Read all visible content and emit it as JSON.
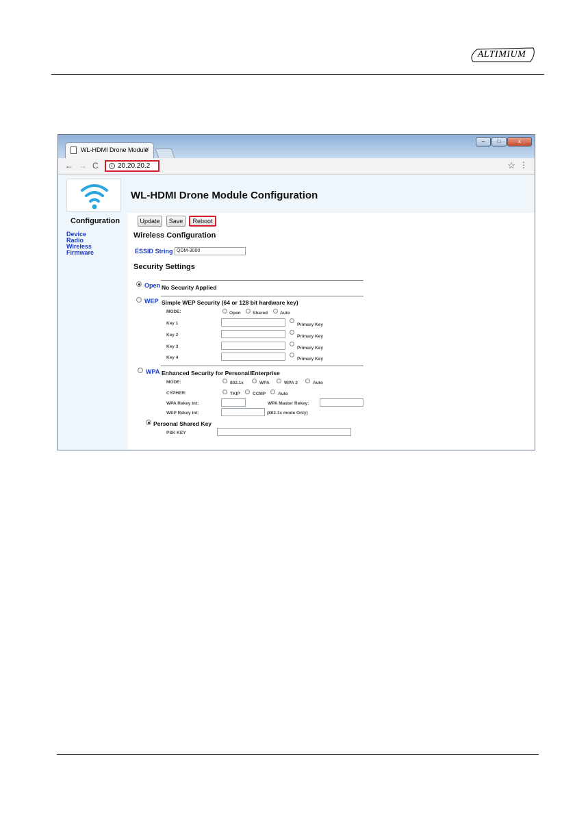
{
  "document": {
    "logo_text": "ALTIMIUM"
  },
  "browser": {
    "tab_title": "WL-HDMI Drone Module",
    "tab_close": "×",
    "address": "20.20.20.2",
    "nav": {
      "back": "←",
      "forward": "→",
      "reload": "C"
    },
    "star": "☆",
    "menu": "⋮",
    "window_buttons": {
      "minimize": "–",
      "maximize": "□",
      "close": "x"
    }
  },
  "page": {
    "title": "WL-HDMI Drone Module Configuration",
    "sidebar": {
      "title": "Configuration",
      "links": [
        "Device",
        "Radio",
        "Wireless",
        "Firmware"
      ]
    },
    "buttons": {
      "update": "Update",
      "save": "Save",
      "reboot": "Reboot"
    },
    "wireless": {
      "heading": "Wireless Configuration",
      "essid_label": "ESSID String",
      "essid_value": "QDM-3000"
    },
    "security": {
      "heading": "Security Settings",
      "open": {
        "label": "Open",
        "desc": "No Security Applied",
        "selected": true
      },
      "wep": {
        "label": "WEP",
        "desc": "Simple WEP Security (64 or 128 bit hardware key)",
        "mode_label": "MODE:",
        "mode_options": [
          "Open",
          "Shared",
          "Auto"
        ],
        "keys": [
          "Key 1",
          "Key 2",
          "Key 3",
          "Key 4"
        ],
        "primary_key": "Primary Key"
      },
      "wpa": {
        "label": "WPA",
        "desc": "Enhanced Security for Personal/Enterprise",
        "mode_label": "MODE:",
        "mode_options": [
          "802.1x",
          "WPA",
          "WPA 2",
          "Auto"
        ],
        "cypher_label": "CYPHER:",
        "cypher_options": [
          "TKIP",
          "CCMP",
          "Auto"
        ],
        "rekey_label": "WPA Rekey Int:",
        "master_rekey_label": "WPA Master Rekey:",
        "wep_rekey_label": "WEP Rekey Int:",
        "wep_rekey_note": "(802.1x mode Only)",
        "psk_heading": "Personal Shared Key",
        "psk_label": "PSK KEY"
      }
    }
  },
  "colors": {
    "highlight": "#d11f2a",
    "link": "#1a3bbf"
  }
}
